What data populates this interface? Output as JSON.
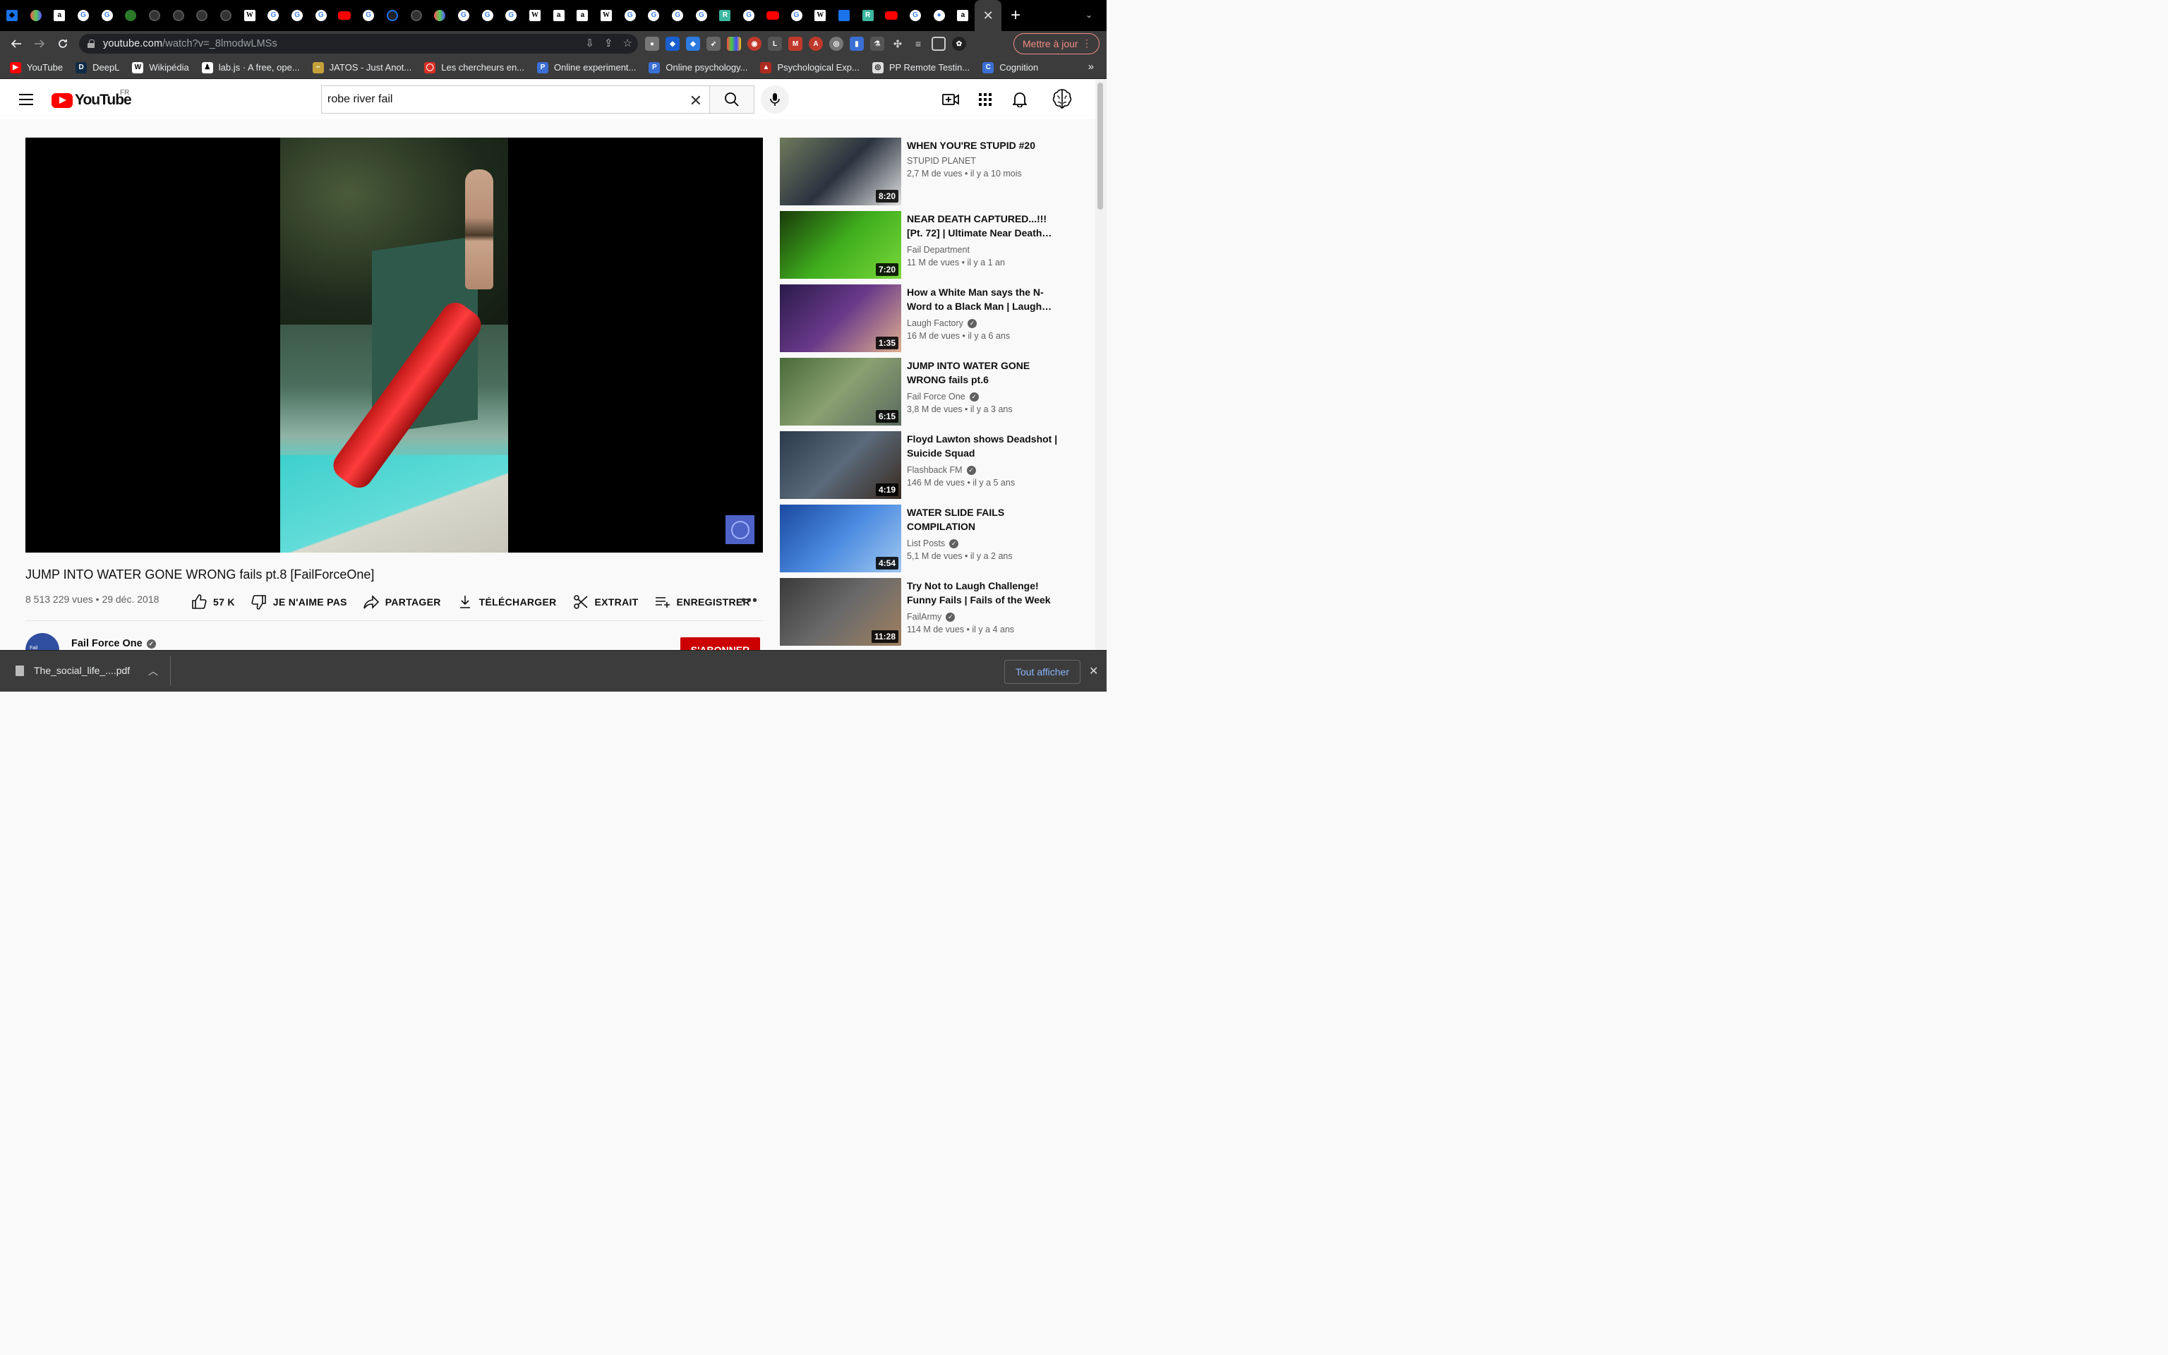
{
  "browser": {
    "tabs": [
      {
        "icon": "gem-icon"
      },
      {
        "icon": "brain-icon"
      },
      {
        "icon": "amazon-icon"
      },
      {
        "icon": "google-icon"
      },
      {
        "icon": "google-icon"
      },
      {
        "icon": "leaf-icon"
      },
      {
        "icon": "github-icon"
      },
      {
        "icon": "github-icon"
      },
      {
        "icon": "github-icon"
      },
      {
        "icon": "github-icon"
      },
      {
        "icon": "wikipedia-icon"
      },
      {
        "icon": "google-icon"
      },
      {
        "icon": "google-icon"
      },
      {
        "icon": "google-icon"
      },
      {
        "icon": "youtube-icon"
      },
      {
        "icon": "google-icon"
      },
      {
        "icon": "orbit-icon"
      },
      {
        "icon": "github-icon"
      },
      {
        "icon": "brain-icon"
      },
      {
        "icon": "google-icon"
      },
      {
        "icon": "google-icon"
      },
      {
        "icon": "google-icon"
      },
      {
        "icon": "wikipedia-icon"
      },
      {
        "icon": "amazon-icon"
      },
      {
        "icon": "amazon-icon"
      },
      {
        "icon": "wikipedia-icon"
      },
      {
        "icon": "google-icon"
      },
      {
        "icon": "google-icon"
      },
      {
        "icon": "google-icon"
      },
      {
        "icon": "google-icon"
      },
      {
        "icon": "researchgate-icon"
      },
      {
        "icon": "google-icon"
      },
      {
        "icon": "youtube-icon"
      },
      {
        "icon": "google-icon"
      },
      {
        "icon": "wikipedia-icon"
      },
      {
        "icon": "blue-line-icon"
      },
      {
        "icon": "researchgate-icon"
      },
      {
        "icon": "youtube-icon"
      },
      {
        "icon": "google-icon"
      },
      {
        "icon": "chrome-icon"
      },
      {
        "icon": "amazon-icon"
      }
    ],
    "url_host": "youtube.com",
    "url_path": "/watch?v=_8lmodwLMSs",
    "update_label": "Mettre à jour",
    "bookmarks": [
      {
        "label": "YouTube",
        "color": "#ff0000",
        "glyph": "▶"
      },
      {
        "label": "DeepL",
        "color": "#0f2b46",
        "glyph": "D"
      },
      {
        "label": "Wikipédia",
        "color": "#ffffff",
        "glyph": "W"
      },
      {
        "label": "lab.js · A free, ope...",
        "color": "#ffffff",
        "glyph": "♟"
      },
      {
        "label": "JATOS - Just Anot...",
        "color": "#c5a13a",
        "glyph": "~"
      },
      {
        "label": "Les chercheurs en...",
        "color": "#d93025",
        "glyph": "◯"
      },
      {
        "label": "Online experiment...",
        "color": "#3b6fd4",
        "glyph": "P"
      },
      {
        "label": "Online psychology...",
        "color": "#3b6fd4",
        "glyph": "P"
      },
      {
        "label": "Psychological Exp...",
        "color": "#b02a1f",
        "glyph": "▲"
      },
      {
        "label": "PP Remote Testin...",
        "color": "#dddddd",
        "glyph": "◎"
      },
      {
        "label": "Cognition",
        "color": "#3b6fd4",
        "glyph": "C"
      }
    ]
  },
  "youtube": {
    "logo_text": "YouTube",
    "region": "FR",
    "search_query": "robe river fail",
    "video": {
      "title": "JUMP INTO WATER GONE WRONG fails pt.8 [FailForceOne]",
      "views": "8 513 229 vues",
      "date": "29 déc. 2018",
      "likes": "57 K",
      "dislike_label": "JE N'AIME PAS",
      "share_label": "PARTAGER",
      "download_label": "TÉLÉCHARGER",
      "clip_label": "EXTRAIT",
      "save_label": "ENREGISTRER"
    },
    "channel": {
      "name": "Fail Force One",
      "avatar_text": "Fail",
      "subscribe_label": "S'ABONNER"
    },
    "related": [
      {
        "title": "WHEN YOU'RE STUPID #20",
        "channel": "STUPID PLANET",
        "verified": false,
        "views": "2,7 M de vues",
        "age": "il y a 10 mois",
        "duration": "8:20",
        "thumb_colors": [
          "#6f7a5c",
          "#2b3340",
          "#e0e0e0"
        ]
      },
      {
        "title": "NEAR DEATH CAPTURED...!!! [Pt. 72] | Ultimate Near Death…",
        "channel": "Fail Department",
        "verified": false,
        "views": "11 M de vues",
        "age": "il y a 1 an",
        "duration": "7:20",
        "thumb_colors": [
          "#1a3a0a",
          "#3fae1d",
          "#7ad83a"
        ]
      },
      {
        "title": "How a White Man says the N-Word to a Black Man | Laugh…",
        "channel": "Laugh Factory",
        "verified": true,
        "views": "16 M de vues",
        "age": "il y a 6 ans",
        "duration": "1:35",
        "thumb_colors": [
          "#2a1a4a",
          "#6a3a8a",
          "#e0b090"
        ]
      },
      {
        "title": "JUMP INTO WATER GONE WRONG fails pt.6 [FailForceOne]",
        "channel": "Fail Force One",
        "verified": true,
        "views": "3,8 M de vues",
        "age": "il y a 3 ans",
        "duration": "6:15",
        "thumb_colors": [
          "#4a6a3a",
          "#8aa070",
          "#5a6a60"
        ]
      },
      {
        "title": "Floyd Lawton shows Deadshot | Suicide Squad",
        "channel": "Flashback FM",
        "verified": true,
        "views": "146 M de vues",
        "age": "il y a 5 ans",
        "duration": "4:19",
        "thumb_colors": [
          "#2a3a4a",
          "#5a6a7a",
          "#3a2a20"
        ]
      },
      {
        "title": "WATER SLIDE FAILS COMPILATION",
        "channel": "List Posts",
        "verified": true,
        "views": "5,1 M de vues",
        "age": "il y a 2 ans",
        "duration": "4:54",
        "thumb_colors": [
          "#1a4aa0",
          "#4a8ae0",
          "#a0c8f0"
        ]
      },
      {
        "title": "Try Not to Laugh Challenge! Funny Fails | Fails of the Week …",
        "channel": "FailArmy",
        "verified": true,
        "views": "114 M de vues",
        "age": "il y a 4 ans",
        "duration": "11:28",
        "thumb_colors": [
          "#3a3a3a",
          "#6a6a6a",
          "#a08060"
        ]
      }
    ]
  },
  "download_bar": {
    "file_name": "The_social_life_....pdf",
    "show_all_label": "Tout afficher"
  }
}
